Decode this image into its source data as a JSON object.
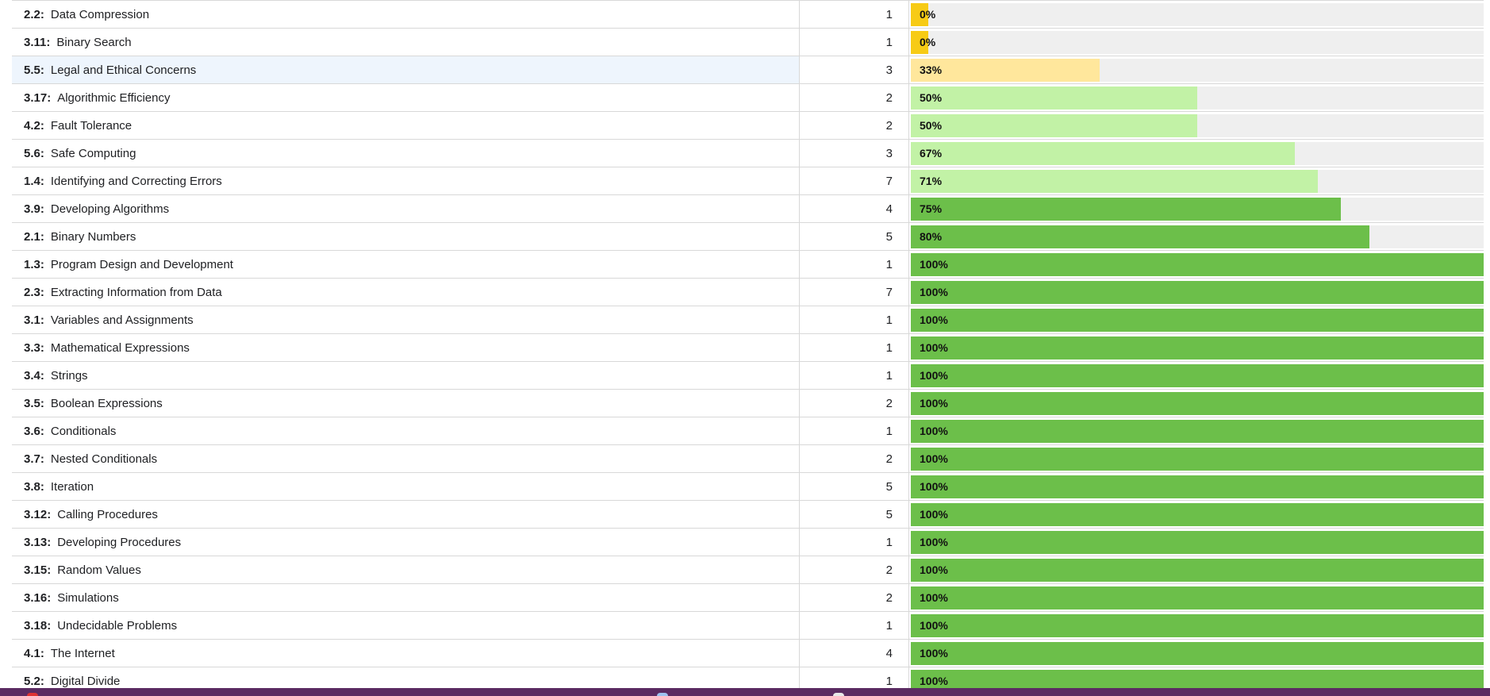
{
  "colors": {
    "zero": "#f7cb15",
    "low": "#ffe79c",
    "mid": "#c2f2a6",
    "high": "#6cbf4a",
    "track": "#efefef",
    "taskbar": "#5b2b62"
  },
  "rows": [
    {
      "code": "2.2:",
      "name": "Data Compression",
      "count": "1",
      "pct_label": "0%",
      "pct": 0.03,
      "level": "zero"
    },
    {
      "code": "3.11:",
      "name": "Binary Search",
      "count": "1",
      "pct_label": "0%",
      "pct": 0.03,
      "level": "zero"
    },
    {
      "code": "5.5:",
      "name": "Legal and Ethical Concerns",
      "count": "3",
      "pct_label": "33%",
      "pct": 0.33,
      "level": "low",
      "highlight": true
    },
    {
      "code": "3.17:",
      "name": "Algorithmic Efficiency",
      "count": "2",
      "pct_label": "50%",
      "pct": 0.5,
      "level": "mid"
    },
    {
      "code": "4.2:",
      "name": "Fault Tolerance",
      "count": "2",
      "pct_label": "50%",
      "pct": 0.5,
      "level": "mid"
    },
    {
      "code": "5.6:",
      "name": "Safe Computing",
      "count": "3",
      "pct_label": "67%",
      "pct": 0.67,
      "level": "mid"
    },
    {
      "code": "1.4:",
      "name": "Identifying and Correcting Errors",
      "count": "7",
      "pct_label": "71%",
      "pct": 0.71,
      "level": "mid"
    },
    {
      "code": "3.9:",
      "name": "Developing Algorithms",
      "count": "4",
      "pct_label": "75%",
      "pct": 0.75,
      "level": "high"
    },
    {
      "code": "2.1:",
      "name": "Binary Numbers",
      "count": "5",
      "pct_label": "80%",
      "pct": 0.8,
      "level": "high"
    },
    {
      "code": "1.3:",
      "name": "Program Design and Development",
      "count": "1",
      "pct_label": "100%",
      "pct": 1.0,
      "level": "high"
    },
    {
      "code": "2.3:",
      "name": "Extracting Information from Data",
      "count": "7",
      "pct_label": "100%",
      "pct": 1.0,
      "level": "high"
    },
    {
      "code": "3.1:",
      "name": "Variables and Assignments",
      "count": "1",
      "pct_label": "100%",
      "pct": 1.0,
      "level": "high"
    },
    {
      "code": "3.3:",
      "name": "Mathematical Expressions",
      "count": "1",
      "pct_label": "100%",
      "pct": 1.0,
      "level": "high"
    },
    {
      "code": "3.4:",
      "name": "Strings",
      "count": "1",
      "pct_label": "100%",
      "pct": 1.0,
      "level": "high"
    },
    {
      "code": "3.5:",
      "name": "Boolean Expressions",
      "count": "2",
      "pct_label": "100%",
      "pct": 1.0,
      "level": "high"
    },
    {
      "code": "3.6:",
      "name": "Conditionals",
      "count": "1",
      "pct_label": "100%",
      "pct": 1.0,
      "level": "high"
    },
    {
      "code": "3.7:",
      "name": "Nested Conditionals",
      "count": "2",
      "pct_label": "100%",
      "pct": 1.0,
      "level": "high"
    },
    {
      "code": "3.8:",
      "name": "Iteration",
      "count": "5",
      "pct_label": "100%",
      "pct": 1.0,
      "level": "high"
    },
    {
      "code": "3.12:",
      "name": "Calling Procedures",
      "count": "5",
      "pct_label": "100%",
      "pct": 1.0,
      "level": "high"
    },
    {
      "code": "3.13:",
      "name": "Developing Procedures",
      "count": "1",
      "pct_label": "100%",
      "pct": 1.0,
      "level": "high"
    },
    {
      "code": "3.15:",
      "name": "Random Values",
      "count": "2",
      "pct_label": "100%",
      "pct": 1.0,
      "level": "high"
    },
    {
      "code": "3.16:",
      "name": "Simulations",
      "count": "2",
      "pct_label": "100%",
      "pct": 1.0,
      "level": "high"
    },
    {
      "code": "3.18:",
      "name": "Undecidable Problems",
      "count": "1",
      "pct_label": "100%",
      "pct": 1.0,
      "level": "high"
    },
    {
      "code": "4.1:",
      "name": "The Internet",
      "count": "4",
      "pct_label": "100%",
      "pct": 1.0,
      "level": "high"
    },
    {
      "code": "5.2:",
      "name": "Digital Divide",
      "count": "1",
      "pct_label": "100%",
      "pct": 1.0,
      "level": "high"
    }
  ]
}
